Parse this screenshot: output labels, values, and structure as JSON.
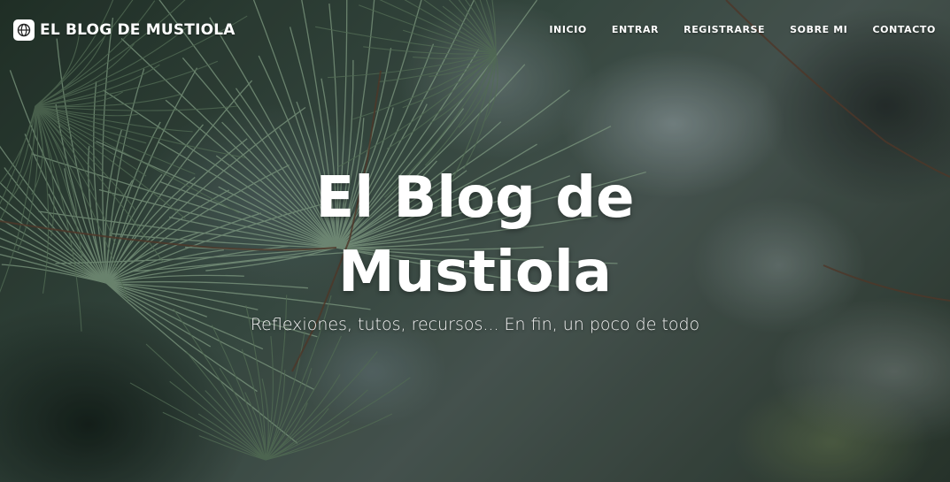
{
  "navbar": {
    "brand": "EL BLOG DE MUSTIOLA",
    "brand_icon": "globe-icon",
    "links": [
      {
        "label": "INICIO"
      },
      {
        "label": "ENTRAR"
      },
      {
        "label": "REGISTRARSE"
      },
      {
        "label": "SOBRE MI"
      },
      {
        "label": "CONTACTO"
      }
    ]
  },
  "hero": {
    "title": "El Blog de Mustiola",
    "subtitle": "Reflexiones, tutos, recursos... En fin, un poco de todo",
    "background": "pine-needles-photo"
  },
  "colors": {
    "text": "#ffffff",
    "background_dark": "#24352b"
  }
}
